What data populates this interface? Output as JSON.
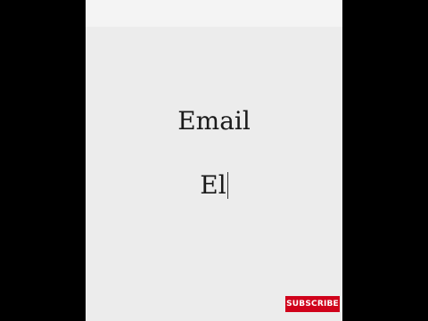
{
  "prompt": {
    "word": "Email"
  },
  "input": {
    "typed_text": "El"
  },
  "overlay": {
    "subscribe_label": "SUBSCRIBE"
  },
  "colors": {
    "subscribe_bg": "#d0021b",
    "page_bg": "#ececec",
    "letterbox": "#000000"
  }
}
